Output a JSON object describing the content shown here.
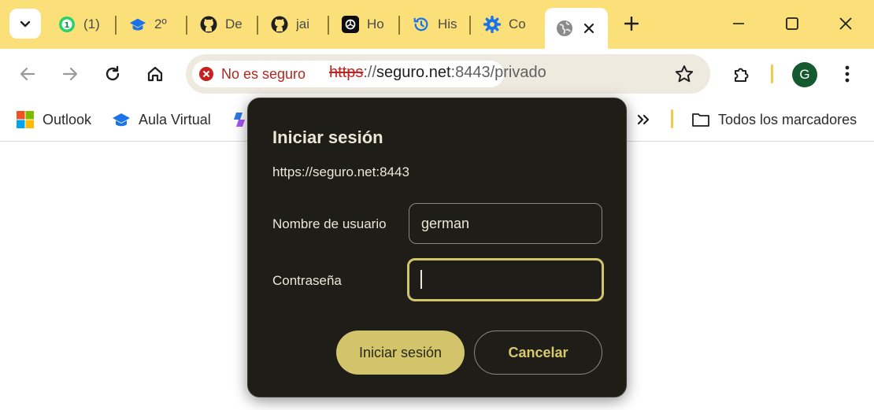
{
  "tabs": [
    {
      "title": "(1)",
      "icon": "whatsapp-icon"
    },
    {
      "title": "2º",
      "icon": "graduation-cap-icon"
    },
    {
      "title": "De",
      "icon": "github-icon"
    },
    {
      "title": "jai",
      "icon": "github-icon"
    },
    {
      "title": "Ho",
      "icon": "chatgpt-icon"
    },
    {
      "title": "His",
      "icon": "history-icon"
    },
    {
      "title": "Co",
      "icon": "gear-icon"
    },
    {
      "title": "",
      "icon": "globe-icon",
      "active": true
    }
  ],
  "toolbar": {
    "security_chip": "No es seguro",
    "url_protocol": "https",
    "url_separator": "://",
    "url_host": "seguro.net",
    "url_rest": ":8443/privado",
    "profile_initial": "G"
  },
  "bookmarks": {
    "items": [
      {
        "label": "Outlook",
        "icon": "outlook-icon"
      },
      {
        "label": "Aula Virtual",
        "icon": "graduation-cap-icon"
      },
      {
        "label": "",
        "icon": "copilot-icon"
      }
    ],
    "all_bookmarks": "Todos los marcadores"
  },
  "dialog": {
    "title": "Iniciar sesión",
    "origin": "https://seguro.net:8443",
    "username_label": "Nombre de usuario",
    "username_value": "german",
    "password_label": "Contraseña",
    "password_value": "",
    "submit_label": "Iniciar sesión",
    "cancel_label": "Cancelar"
  },
  "colors": {
    "tab_strip": "#fbe07a",
    "dialog_bg": "#1e1d18",
    "accent": "#d2c46a"
  }
}
